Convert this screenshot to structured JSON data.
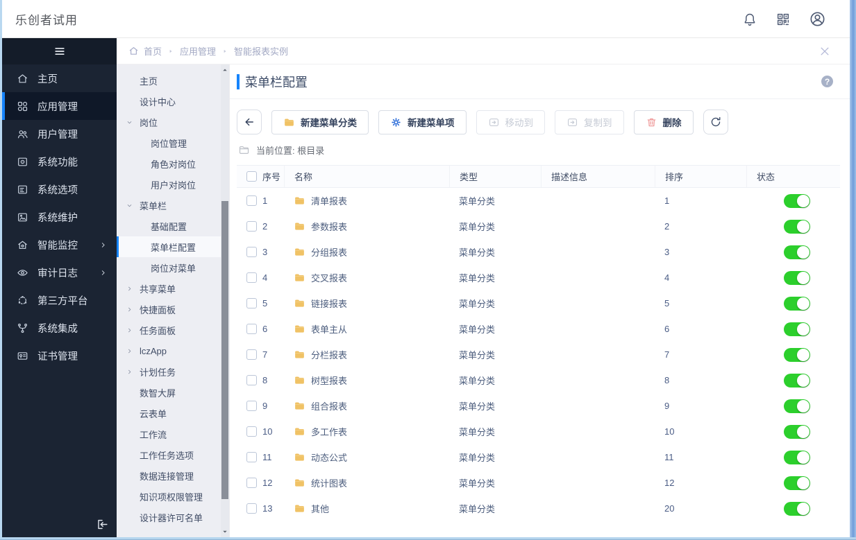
{
  "topbar": {
    "title": "乐创者试用",
    "icons": [
      {
        "name": "notification-bell-icon"
      },
      {
        "name": "qr-code-icon"
      },
      {
        "name": "user-avatar-icon"
      }
    ]
  },
  "sidebar": {
    "items": [
      {
        "id": "home",
        "label": "主页",
        "icon": "home-icon"
      },
      {
        "id": "app-management",
        "label": "应用管理",
        "icon": "apps-icon",
        "active": true
      },
      {
        "id": "user-management",
        "label": "用户管理",
        "icon": "users-icon"
      },
      {
        "id": "system-functions",
        "label": "系统功能",
        "icon": "system-function-icon"
      },
      {
        "id": "system-options",
        "label": "系统选项",
        "icon": "system-options-icon"
      },
      {
        "id": "system-maintenance",
        "label": "系统维护",
        "icon": "system-maintenance-icon"
      },
      {
        "id": "smart-monitoring",
        "label": "智能监控",
        "icon": "smart-monitor-icon",
        "chevron": true
      },
      {
        "id": "audit-logs",
        "label": "审计日志",
        "icon": "audit-log-icon",
        "chevron": true
      },
      {
        "id": "third-party-platform",
        "label": "第三方平台",
        "icon": "third-party-icon"
      },
      {
        "id": "system-integration",
        "label": "系统集成",
        "icon": "integration-icon"
      },
      {
        "id": "certificate-management",
        "label": "证书管理",
        "icon": "certificate-icon"
      }
    ]
  },
  "submenu": {
    "items": [
      {
        "id": "home",
        "label": "主页",
        "level": 1
      },
      {
        "id": "design-center",
        "label": "设计中心",
        "level": 1
      },
      {
        "id": "post",
        "label": "岗位",
        "level": 0,
        "expand": "open"
      },
      {
        "id": "post-management",
        "label": "岗位管理",
        "level": 2
      },
      {
        "id": "role-to-post",
        "label": "角色对岗位",
        "level": 2
      },
      {
        "id": "user-to-post",
        "label": "用户对岗位",
        "level": 2
      },
      {
        "id": "menu-bar",
        "label": "菜单栏",
        "level": 0,
        "expand": "open"
      },
      {
        "id": "basic-config",
        "label": "基础配置",
        "level": 2
      },
      {
        "id": "menu-bar-config",
        "label": "菜单栏配置",
        "level": 2,
        "active": true
      },
      {
        "id": "post-to-menu",
        "label": "岗位对菜单",
        "level": 2
      },
      {
        "id": "shared-menu",
        "label": "共享菜单",
        "level": 0,
        "expand": "closed"
      },
      {
        "id": "quick-panel",
        "label": "快捷面板",
        "level": 0,
        "expand": "closed"
      },
      {
        "id": "task-panel",
        "label": "任务面板",
        "level": 0,
        "expand": "closed"
      },
      {
        "id": "lczapp",
        "label": "lczApp",
        "level": 0,
        "expand": "closed"
      },
      {
        "id": "scheduled-tasks",
        "label": "计划任务",
        "level": 0,
        "expand": "closed"
      },
      {
        "id": "data-screen",
        "label": "数智大屏",
        "level": 1
      },
      {
        "id": "cloud-form",
        "label": "云表单",
        "level": 1
      },
      {
        "id": "workflow",
        "label": "工作流",
        "level": 1
      },
      {
        "id": "work-task-options",
        "label": "工作任务选项",
        "level": 1
      },
      {
        "id": "data-connection-management",
        "label": "数据连接管理",
        "level": 1
      },
      {
        "id": "knowledge-permission-management",
        "label": "知识项权限管理",
        "level": 1
      },
      {
        "id": "designer-license-list",
        "label": "设计器许可名单",
        "level": 1
      }
    ]
  },
  "breadcrumb": {
    "items": [
      "首页",
      "应用管理",
      "智能报表实例"
    ]
  },
  "page": {
    "title": "菜单栏配置",
    "help_label": "?"
  },
  "toolbar": {
    "buttons": [
      {
        "id": "back",
        "icon": "back-arrow-icon",
        "label": "",
        "kind": "icon"
      },
      {
        "id": "new-menu-category",
        "icon": "folder-icon",
        "label": "新建菜单分类"
      },
      {
        "id": "new-menu-item",
        "icon": "gear-icon",
        "label": "新建菜单项"
      },
      {
        "id": "move-to",
        "icon": "move-to-icon",
        "label": "移动到",
        "disabled": true
      },
      {
        "id": "copy-to",
        "icon": "copy-to-icon",
        "label": "复制到",
        "disabled": true
      },
      {
        "id": "delete",
        "icon": "trash-icon",
        "label": "删除"
      },
      {
        "id": "refresh",
        "icon": "refresh-icon",
        "label": "",
        "kind": "icon"
      }
    ]
  },
  "location": {
    "text": "当前位置: 根目录"
  },
  "table": {
    "headers": [
      "序号",
      "名称",
      "类型",
      "描述信息",
      "排序",
      "状态"
    ],
    "rows": [
      {
        "index": "1",
        "name": "清单报表",
        "type": "菜单分类",
        "desc": "",
        "sort": "1",
        "status": true
      },
      {
        "index": "2",
        "name": "参数报表",
        "type": "菜单分类",
        "desc": "",
        "sort": "2",
        "status": true
      },
      {
        "index": "3",
        "name": "分组报表",
        "type": "菜单分类",
        "desc": "",
        "sort": "3",
        "status": true
      },
      {
        "index": "4",
        "name": "交叉报表",
        "type": "菜单分类",
        "desc": "",
        "sort": "4",
        "status": true
      },
      {
        "index": "5",
        "name": "链接报表",
        "type": "菜单分类",
        "desc": "",
        "sort": "5",
        "status": true
      },
      {
        "index": "6",
        "name": "表单主从",
        "type": "菜单分类",
        "desc": "",
        "sort": "6",
        "status": true
      },
      {
        "index": "7",
        "name": "分栏报表",
        "type": "菜单分类",
        "desc": "",
        "sort": "7",
        "status": true
      },
      {
        "index": "8",
        "name": "树型报表",
        "type": "菜单分类",
        "desc": "",
        "sort": "8",
        "status": true
      },
      {
        "index": "9",
        "name": "组合报表",
        "type": "菜单分类",
        "desc": "",
        "sort": "9",
        "status": true
      },
      {
        "index": "10",
        "name": "多工作表",
        "type": "菜单分类",
        "desc": "",
        "sort": "10",
        "status": true
      },
      {
        "index": "11",
        "name": "动态公式",
        "type": "菜单分类",
        "desc": "",
        "sort": "11",
        "status": true
      },
      {
        "index": "12",
        "name": "统计图表",
        "type": "菜单分类",
        "desc": "",
        "sort": "12",
        "status": true
      },
      {
        "index": "13",
        "name": "其他",
        "type": "菜单分类",
        "desc": "",
        "sort": "20",
        "status": true
      }
    ]
  },
  "colors": {
    "accent": "#1684fc",
    "toggle_on": "#2ccf2c",
    "folder_yellow": "#f3c567",
    "gear_blue": "#2a6bd8",
    "trash_red": "#ef9b9b",
    "dark_sidebar": "#1b2433"
  }
}
